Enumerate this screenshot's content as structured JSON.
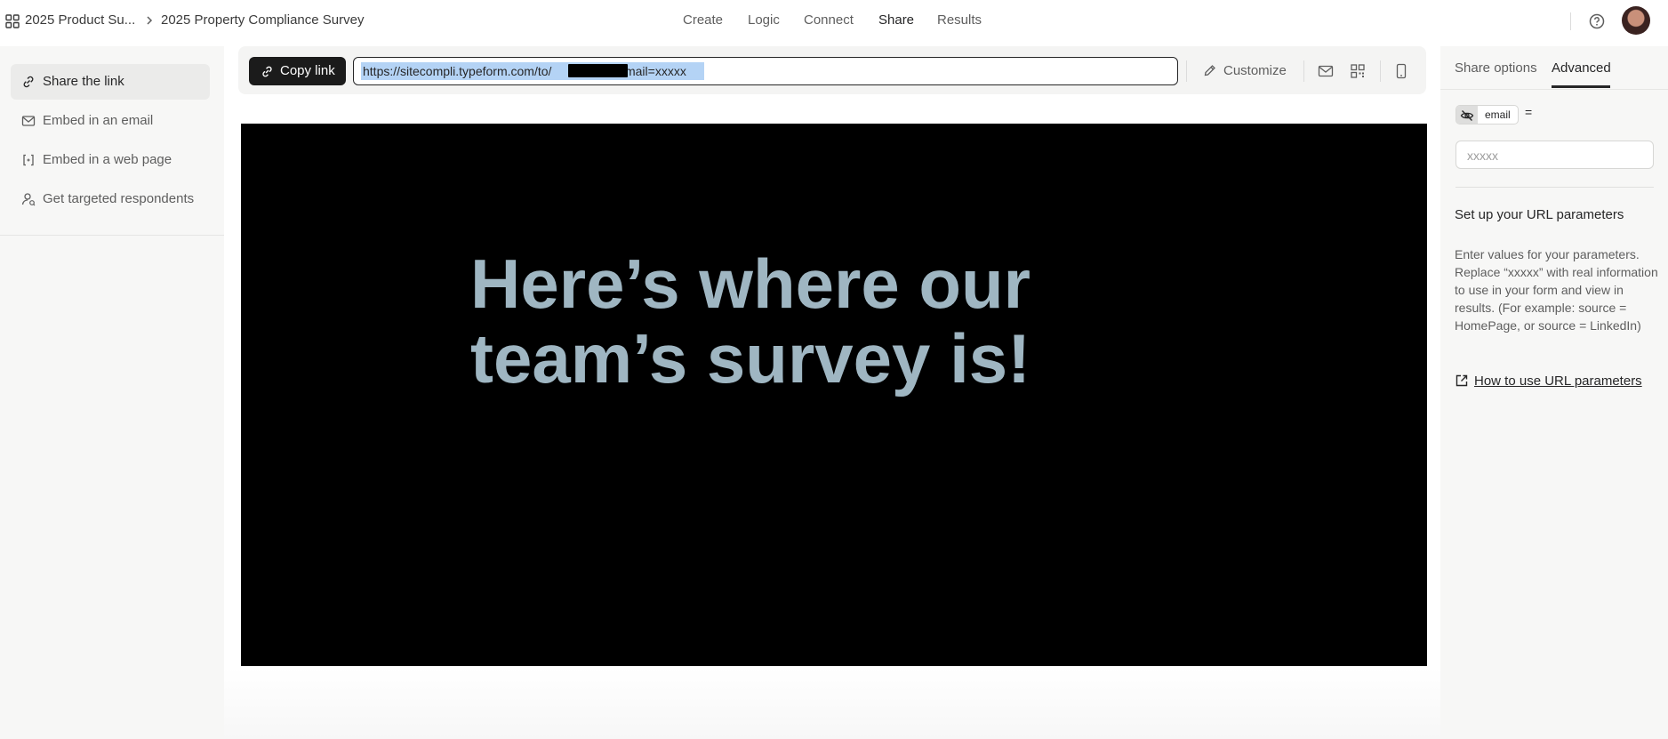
{
  "breadcrumb": {
    "workspace": "2025 Product Su...",
    "form": "2025 Property Compliance Survey"
  },
  "nav": {
    "create": "Create",
    "logic": "Logic",
    "connect": "Connect",
    "share": "Share",
    "results": "Results",
    "active": "Share"
  },
  "sidebar": {
    "items": [
      {
        "label": "Share the link",
        "icon": "link-icon",
        "active": true
      },
      {
        "label": "Embed in an email",
        "icon": "mail-icon",
        "active": false
      },
      {
        "label": "Embed in a web page",
        "icon": "embed-code-icon",
        "active": false
      },
      {
        "label": "Get targeted respondents",
        "icon": "user-target-icon",
        "active": false
      }
    ]
  },
  "toolbar": {
    "copy_label": "Copy link",
    "url_prefix": "https://sitecompli.typeform.com/to/",
    "url_suffix": "#email=xxxxx",
    "customize_label": "Customize",
    "icons": [
      "mail-icon",
      "qr-code-icon",
      "mobile-icon"
    ]
  },
  "preview": {
    "heading": "Here’s where our team’s survey is!",
    "background": "#000000",
    "text_color": "#9fb6c2"
  },
  "right_panel": {
    "tabs": {
      "share_options": "Share options",
      "advanced": "Advanced",
      "active": "Advanced"
    },
    "param_name": "email",
    "param_equals": "=",
    "param_placeholder": "xxxxx",
    "heading": "Set up your URL parameters",
    "description": "Enter values for your parameters. Replace “xxxxx” with real information to use in your form and view in results. (For example: source = HomePage, or source = LinkedIn)",
    "link_label": "How to use URL parameters"
  },
  "colors": {
    "accent_dark": "#1b1b1b",
    "selection": "#b4d3f5"
  }
}
